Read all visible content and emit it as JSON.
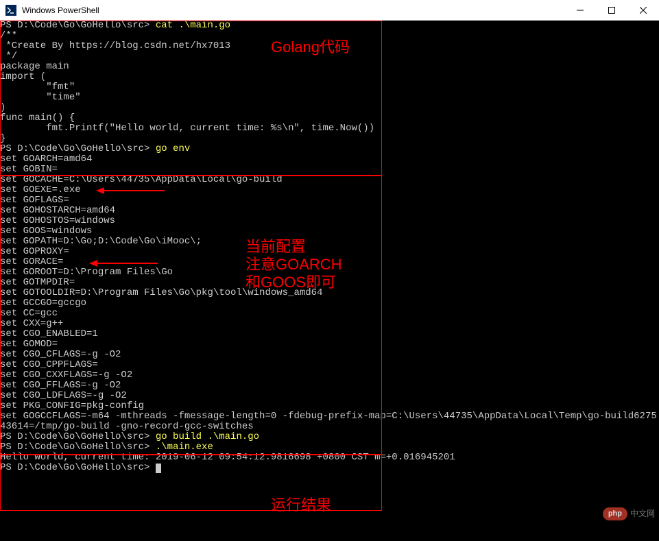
{
  "window": {
    "title": "Windows PowerShell"
  },
  "terminal": {
    "section1": {
      "prompt1": "PS D:\\Code\\Go\\GoHello\\src> ",
      "cmd1": "cat .\\main.go",
      "lines": [
        "/**",
        " *Create By https://blog.csdn.net/hx7013",
        " */",
        "",
        "package main",
        "",
        "import (",
        "        \"fmt\"",
        "        \"time\"",
        ")",
        "",
        "func main() {",
        "        fmt.Printf(\"Hello world, current time: %s\\n\", time.Now())",
        "}"
      ]
    },
    "section2": {
      "prompt1": "PS D:\\Code\\Go\\GoHello\\src> ",
      "cmd1": "go env",
      "lines": [
        "set GOARCH=amd64",
        "set GOBIN=",
        "set GOCACHE=C:\\Users\\44735\\AppData\\Local\\go-build",
        "set GOEXE=.exe",
        "set GOFLAGS=",
        "set GOHOSTARCH=amd64",
        "set GOHOSTOS=windows",
        "set GOOS=windows",
        "set GOPATH=D:\\Go;D:\\Code\\Go\\iMooc\\;",
        "set GOPROXY=",
        "set GORACE=",
        "set GOROOT=D:\\Program Files\\Go",
        "set GOTMPDIR=",
        "set GOTOOLDIR=D:\\Program Files\\Go\\pkg\\tool\\windows_amd64",
        "set GCCGO=gccgo",
        "set CC=gcc",
        "set CXX=g++",
        "set CGO_ENABLED=1",
        "set GOMOD=",
        "set CGO_CFLAGS=-g -O2",
        "set CGO_CPPFLAGS=",
        "set CGO_CXXFLAGS=-g -O2",
        "set CGO_FFLAGS=-g -O2",
        "set CGO_LDFLAGS=-g -O2",
        "set PKG_CONFIG=pkg-config",
        "set GOGCCFLAGS=-m64 -mthreads -fmessage-length=0 -fdebug-prefix-map=C:\\Users\\44735\\AppData\\Local\\Temp\\go-build627543614=/tmp/go-build -gno-record-gcc-switches"
      ]
    },
    "section3": {
      "prompt1": "PS D:\\Code\\Go\\GoHello\\src> ",
      "cmd1": "go build .\\main.go",
      "prompt2": "PS D:\\Code\\Go\\GoHello\\src> ",
      "cmd2": ".\\main.exe",
      "output": "Hello world, current time: 2019-06-12 09:54:12.9816698 +0800 CST m=+0.016945201",
      "prompt3": "PS D:\\Code\\Go\\GoHello\\src> "
    }
  },
  "annotations": {
    "label1": "Golang代码",
    "label2": "当前配置\n注意GOARCH\n和GOOS即可",
    "label3": "运行结果"
  },
  "watermark": {
    "badge": "php",
    "text": "中文网"
  }
}
